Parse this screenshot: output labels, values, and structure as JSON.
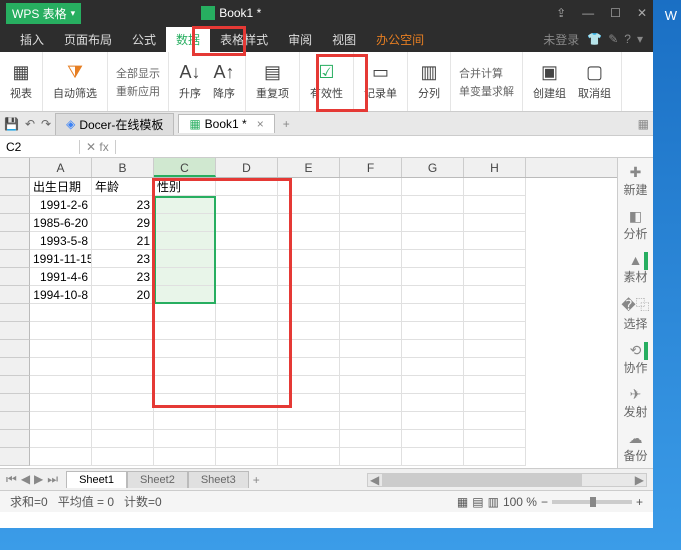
{
  "title": {
    "app": "WPS 表格",
    "doc": "Book1 *"
  },
  "window_external": "W",
  "menus": [
    "插入",
    "页面布局",
    "公式",
    "数据",
    "表格样式",
    "审阅",
    "视图",
    "办公空间"
  ],
  "login": "未登录",
  "ribbon": {
    "pivot": "视表",
    "filter": "自动筛选",
    "showall": "全部显示",
    "reapply": "重新应用",
    "sort_asc": "升序",
    "sort_desc": "降序",
    "duplicates": "重复项",
    "validation": "有效性",
    "form": "记录单",
    "text_to_col": "分列",
    "consolidate": "合并计算",
    "solver": "单变量求解",
    "group": "创建组",
    "ungroup": "取消组"
  },
  "doctabs": {
    "docer": "Docer-在线模板",
    "book": "Book1 *"
  },
  "namebox": "C2",
  "fx_label": "fx",
  "columns": [
    "A",
    "B",
    "C",
    "D",
    "E",
    "F",
    "G",
    "H"
  ],
  "headers": {
    "a": "出生日期",
    "b": "年龄",
    "c": "性别"
  },
  "rows": [
    {
      "a": "1991-2-6",
      "b": "23"
    },
    {
      "a": "1985-6-20",
      "b": "29"
    },
    {
      "a": "1993-5-8",
      "b": "21"
    },
    {
      "a": "1991-11-15",
      "b": "23"
    },
    {
      "a": "1991-4-6",
      "b": "23"
    },
    {
      "a": "1994-10-8",
      "b": "20"
    }
  ],
  "side": {
    "new": "新建",
    "analyze": "分析",
    "material": "素材",
    "select": "选择",
    "collab": "协作",
    "send": "发射",
    "backup": "备份"
  },
  "sheets": [
    "Sheet1",
    "Sheet2",
    "Sheet3"
  ],
  "status": {
    "sum": "求和=0",
    "avg": "平均值 = 0",
    "count": "计数=0",
    "zoom": "100 %"
  }
}
